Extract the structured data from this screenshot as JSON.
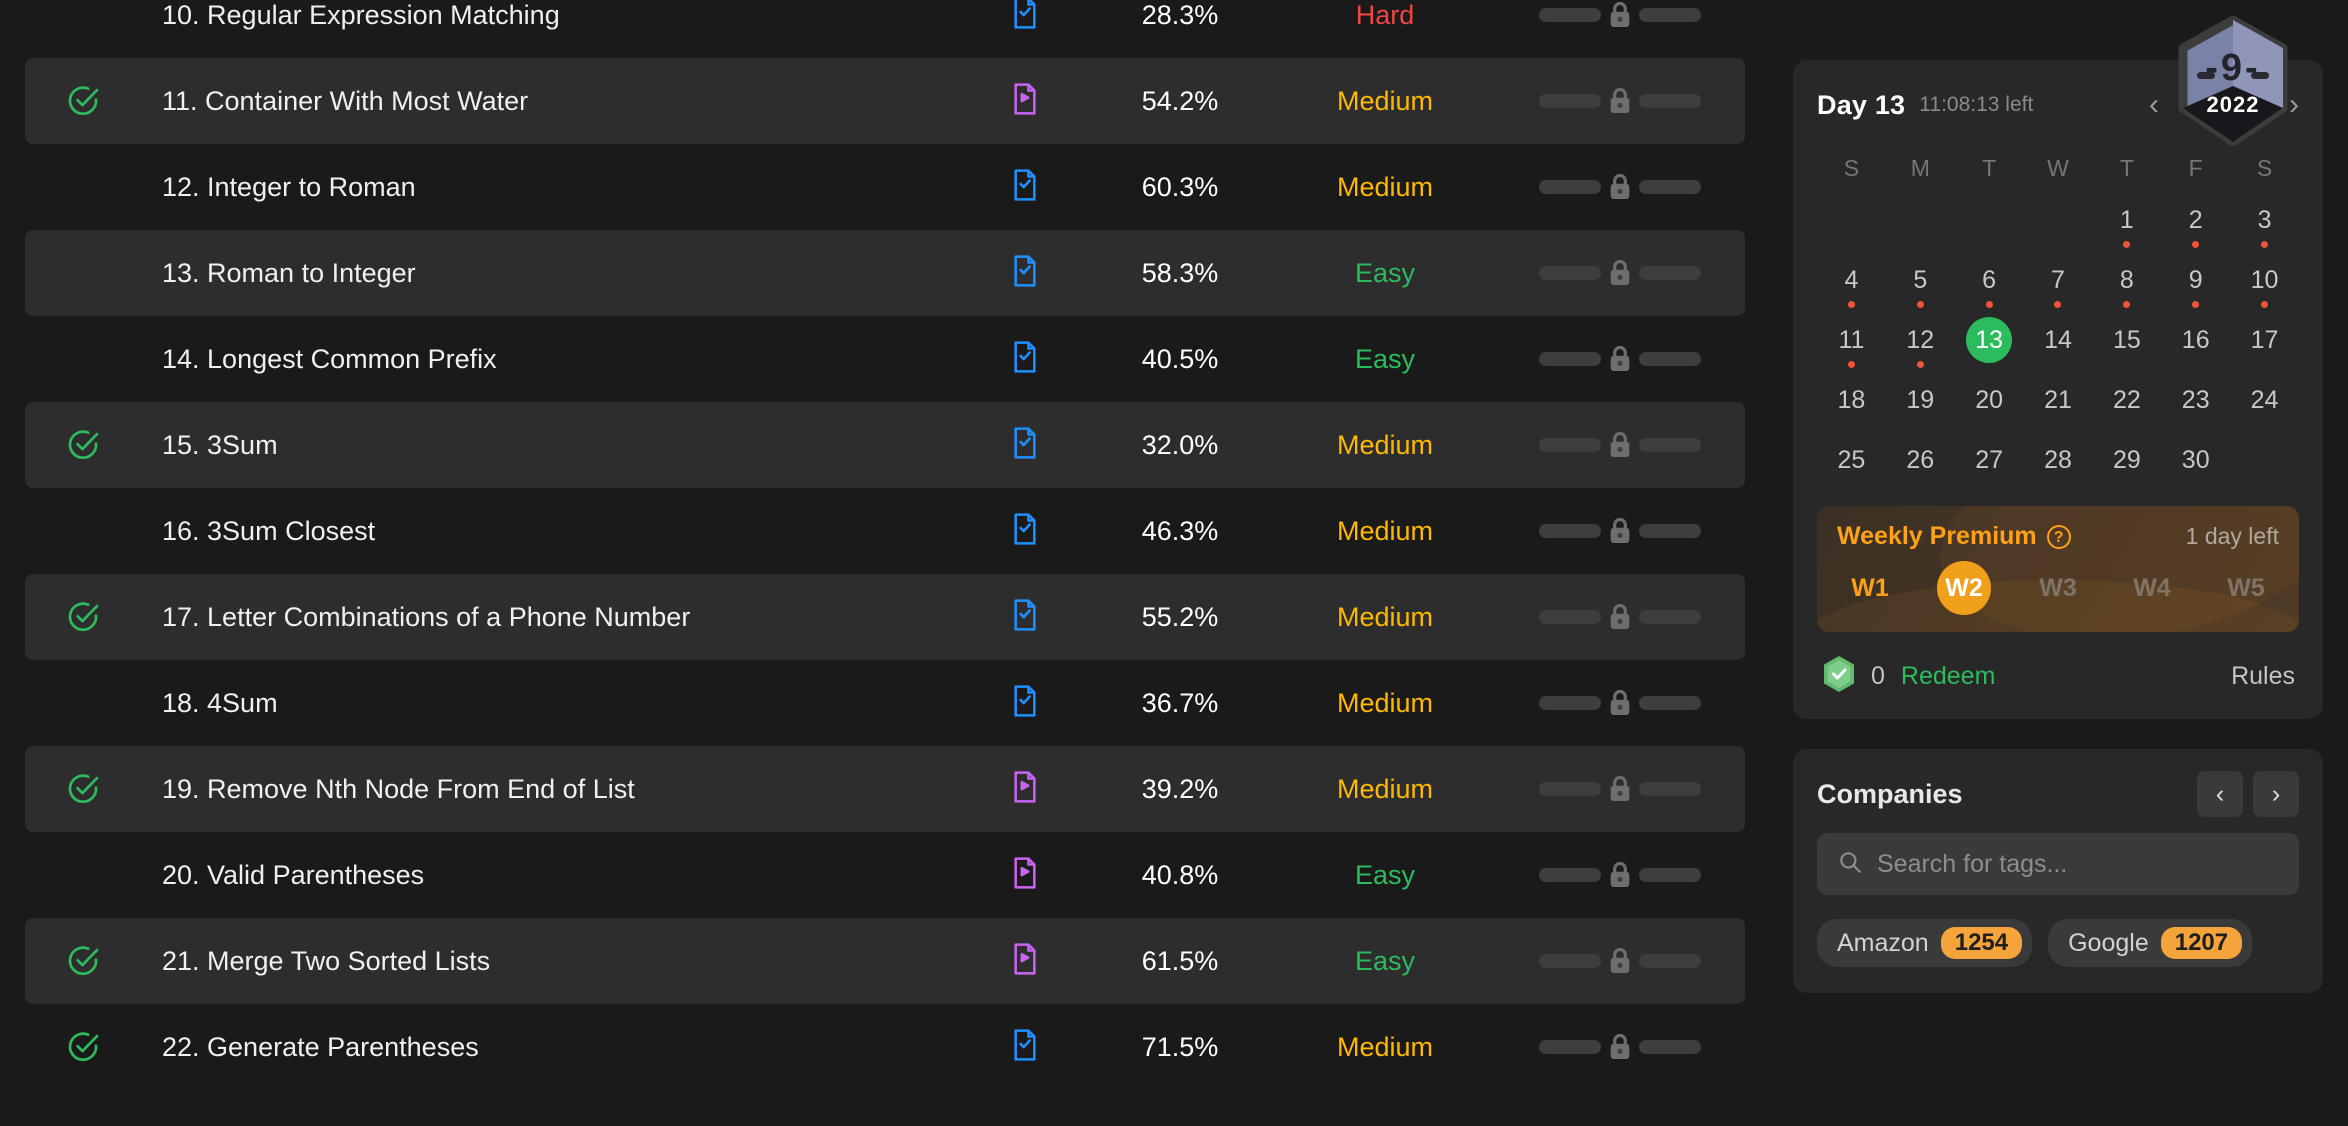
{
  "colors": {
    "easy": "#2cbb5d",
    "medium": "#ffb800",
    "hard": "#ef4743",
    "accent_orange": "#ffa116",
    "today_green": "#2cbb5d",
    "row_alt": "#2d2d2d",
    "page_bg": "#1a1a1a",
    "solution_video": "#c964f2",
    "solution_article": "#1e90ff"
  },
  "table": {
    "rows": [
      {
        "solved": false,
        "title": "10. Regular Expression Matching",
        "solution": "article-icon",
        "acceptance": "28.3%",
        "difficulty": "Hard",
        "frequency_locked": true
      },
      {
        "solved": true,
        "title": "11. Container With Most Water",
        "solution": "video-icon",
        "acceptance": "54.2%",
        "difficulty": "Medium",
        "frequency_locked": true
      },
      {
        "solved": false,
        "title": "12. Integer to Roman",
        "solution": "article-icon",
        "acceptance": "60.3%",
        "difficulty": "Medium",
        "frequency_locked": true
      },
      {
        "solved": false,
        "title": "13. Roman to Integer",
        "solution": "article-icon",
        "acceptance": "58.3%",
        "difficulty": "Easy",
        "frequency_locked": true
      },
      {
        "solved": false,
        "title": "14. Longest Common Prefix",
        "solution": "article-icon",
        "acceptance": "40.5%",
        "difficulty": "Easy",
        "frequency_locked": true
      },
      {
        "solved": true,
        "title": "15. 3Sum",
        "solution": "article-icon",
        "acceptance": "32.0%",
        "difficulty": "Medium",
        "frequency_locked": true
      },
      {
        "solved": false,
        "title": "16. 3Sum Closest",
        "solution": "article-icon",
        "acceptance": "46.3%",
        "difficulty": "Medium",
        "frequency_locked": true
      },
      {
        "solved": true,
        "title": "17. Letter Combinations of a Phone Number",
        "solution": "article-icon",
        "acceptance": "55.2%",
        "difficulty": "Medium",
        "frequency_locked": true
      },
      {
        "solved": false,
        "title": "18. 4Sum",
        "solution": "article-icon",
        "acceptance": "36.7%",
        "difficulty": "Medium",
        "frequency_locked": true
      },
      {
        "solved": true,
        "title": "19. Remove Nth Node From End of List",
        "solution": "video-icon",
        "acceptance": "39.2%",
        "difficulty": "Medium",
        "frequency_locked": true
      },
      {
        "solved": false,
        "title": "20. Valid Parentheses",
        "solution": "video-icon",
        "acceptance": "40.8%",
        "difficulty": "Easy",
        "frequency_locked": true
      },
      {
        "solved": true,
        "title": "21. Merge Two Sorted Lists",
        "solution": "video-icon",
        "acceptance": "61.5%",
        "difficulty": "Easy",
        "frequency_locked": true
      },
      {
        "solved": true,
        "title": "22. Generate Parentheses",
        "solution": "article-icon",
        "acceptance": "71.5%",
        "difficulty": "Medium",
        "frequency_locked": true
      }
    ]
  },
  "daily": {
    "badge": {
      "number": "-9-",
      "year": "2022"
    },
    "title": "Day 13",
    "timer": "11:08:13 left",
    "prev_arrow": "‹",
    "next_arrow": "›",
    "weekdays": [
      "S",
      "M",
      "T",
      "W",
      "T",
      "F",
      "S"
    ],
    "leading_blanks": 4,
    "days": [
      {
        "n": "1",
        "dot": true
      },
      {
        "n": "2",
        "dot": true
      },
      {
        "n": "3",
        "dot": true
      },
      {
        "n": "4",
        "dot": true
      },
      {
        "n": "5",
        "dot": true
      },
      {
        "n": "6",
        "dot": true
      },
      {
        "n": "7",
        "dot": true
      },
      {
        "n": "8",
        "dot": true
      },
      {
        "n": "9",
        "dot": true
      },
      {
        "n": "10",
        "dot": true
      },
      {
        "n": "11",
        "dot": true
      },
      {
        "n": "12",
        "dot": true
      },
      {
        "n": "13",
        "dot": false,
        "today": true
      },
      {
        "n": "14",
        "dot": false
      },
      {
        "n": "15",
        "dot": false
      },
      {
        "n": "16",
        "dot": false
      },
      {
        "n": "17",
        "dot": false
      },
      {
        "n": "18",
        "dot": false
      },
      {
        "n": "19",
        "dot": false
      },
      {
        "n": "20",
        "dot": false
      },
      {
        "n": "21",
        "dot": false
      },
      {
        "n": "22",
        "dot": false
      },
      {
        "n": "23",
        "dot": false
      },
      {
        "n": "24",
        "dot": false
      },
      {
        "n": "25",
        "dot": false
      },
      {
        "n": "26",
        "dot": false
      },
      {
        "n": "27",
        "dot": false
      },
      {
        "n": "28",
        "dot": false
      },
      {
        "n": "29",
        "dot": false
      },
      {
        "n": "30",
        "dot": false
      }
    ],
    "premium": {
      "title": "Weekly Premium",
      "help": "?",
      "time_left": "1 day left",
      "weeks": [
        {
          "label": "W1",
          "state": "done"
        },
        {
          "label": "W2",
          "state": "active"
        },
        {
          "label": "W3",
          "state": "future"
        },
        {
          "label": "W4",
          "state": "future"
        },
        {
          "label": "W5",
          "state": "future"
        }
      ]
    },
    "redeem": {
      "coin_count": "0",
      "redeem_label": "Redeem",
      "rules_label": "Rules"
    }
  },
  "companies": {
    "title": "Companies",
    "prev_arrow": "‹",
    "next_arrow": "›",
    "search_placeholder": "Search for tags...",
    "search_value": "",
    "tags": [
      {
        "name": "Amazon",
        "count": "1254"
      },
      {
        "name": "Google",
        "count": "1207"
      }
    ]
  }
}
